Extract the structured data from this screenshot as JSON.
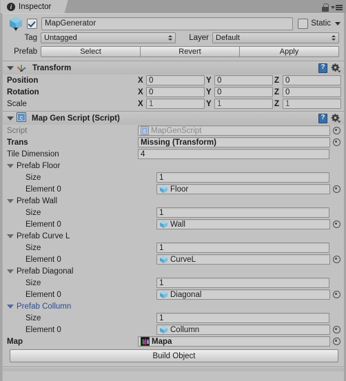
{
  "window": {
    "tab_label": "Inspector",
    "tab_icon": "info-icon",
    "lock_icon": "lock-icon",
    "menu_icon": "hamburger-menu-icon"
  },
  "gameobject": {
    "icon": "cube-icon",
    "enabled": true,
    "name": "MapGenerator",
    "static_label": "Static",
    "static_checked": false,
    "tag_label": "Tag",
    "tag_value": "Untagged",
    "layer_label": "Layer",
    "layer_value": "Default",
    "prefab_label": "Prefab",
    "prefab_buttons": [
      "Select",
      "Revert",
      "Apply"
    ]
  },
  "transform": {
    "title": "Transform",
    "icon": "transform-axis-icon",
    "help_icon": "help-book-icon",
    "gear_icon": "gear-icon",
    "axes": [
      "X",
      "Y",
      "Z"
    ],
    "rows": [
      {
        "label": "Position",
        "bold": true,
        "values": [
          "0",
          "0",
          "0"
        ]
      },
      {
        "label": "Rotation",
        "bold": true,
        "values": [
          "0",
          "0",
          "0"
        ]
      },
      {
        "label": "Scale",
        "bold": false,
        "values": [
          "1",
          "1",
          "1"
        ]
      }
    ]
  },
  "map_gen_script": {
    "title": "Map Gen Script (Script)",
    "icon": "csharp-script-icon",
    "help_icon": "help-book-icon",
    "gear_icon": "gear-icon",
    "script_row": {
      "label": "Script",
      "value": "MapGenScript",
      "icon": "csharp-script-icon",
      "picker": "object-picker-icon"
    },
    "trans_row": {
      "label": "Trans",
      "value": "Missing (Transform)",
      "picker": "object-picker-icon"
    },
    "tile_dimension_row": {
      "label": "Tile Dimension",
      "value": "4"
    },
    "arrays": [
      {
        "name": "Prefab Floor",
        "highlight": false,
        "size_label": "Size",
        "size_value": "1",
        "element_label": "Element 0",
        "element_value": "Floor",
        "element_icon": "prefab-cube-icon",
        "picker": "object-picker-icon"
      },
      {
        "name": "Prefab Wall",
        "highlight": false,
        "size_label": "Size",
        "size_value": "1",
        "element_label": "Element 0",
        "element_value": "Wall",
        "element_icon": "prefab-cube-icon",
        "picker": "object-picker-icon"
      },
      {
        "name": "Prefab Curve L",
        "highlight": false,
        "size_label": "Size",
        "size_value": "1",
        "element_label": "Element 0",
        "element_value": "CurveL",
        "element_icon": "prefab-cube-icon",
        "picker": "object-picker-icon"
      },
      {
        "name": "Prefab Diagonal",
        "highlight": false,
        "size_label": "Size",
        "size_value": "1",
        "element_label": "Element 0",
        "element_value": "Diagonal",
        "element_icon": "prefab-cube-icon",
        "picker": "object-picker-icon"
      },
      {
        "name": "Prefab Collumn",
        "highlight": true,
        "size_label": "Size",
        "size_value": "1",
        "element_label": "Element 0",
        "element_value": "Collumn",
        "element_icon": "prefab-cube-icon",
        "picker": "object-picker-icon"
      }
    ],
    "map_row": {
      "label": "Map",
      "value": "Mapa",
      "icon": "texture-thumbnail-icon",
      "picker": "object-picker-icon"
    },
    "build_button": "Build Object"
  },
  "colors": {
    "panel_bg": "#c2c2c2",
    "window_bg": "#9b9b9b",
    "field_bg": "#cfcfcf",
    "field_border": "#8c8c8c",
    "highlight_blue": "#2c4c93",
    "checkbox_check": "#1f4f86",
    "help_blue": "#3a6ea5"
  }
}
